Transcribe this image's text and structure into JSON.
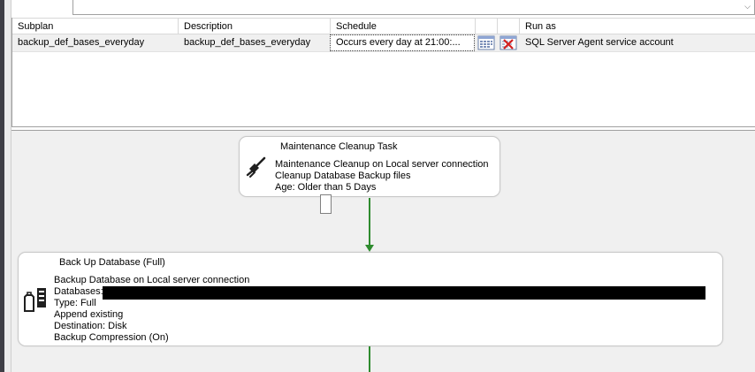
{
  "grid": {
    "columns": [
      "Subplan",
      "Description",
      "Schedule",
      "",
      "",
      "Run as"
    ],
    "row": {
      "subplan": "backup_def_bases_everyday",
      "description": "backup_def_bases_everyday",
      "schedule": "Occurs every day at 21:00:...",
      "run_as": "SQL Server Agent service account"
    }
  },
  "cleanup_task": {
    "title": "Maintenance Cleanup Task",
    "lines": [
      "Maintenance Cleanup on Local server connection",
      "Cleanup Database Backup files",
      "Age: Older than 5 Days"
    ]
  },
  "backup_task": {
    "title": "Back Up Database (Full)",
    "lines": [
      "Backup Database on Local server connection",
      "Databases:",
      "Type: Full",
      "Append existing",
      "Destination: Disk",
      "Backup Compression (On)"
    ]
  },
  "icons": {
    "cleanup": "broom-icon",
    "backup": "database-backup-icon",
    "schedule": "calendar-icon",
    "remove_schedule": "remove-schedule-icon"
  },
  "colors": {
    "connector": "#2e8b2e",
    "canvas": "#f0f0f0"
  }
}
